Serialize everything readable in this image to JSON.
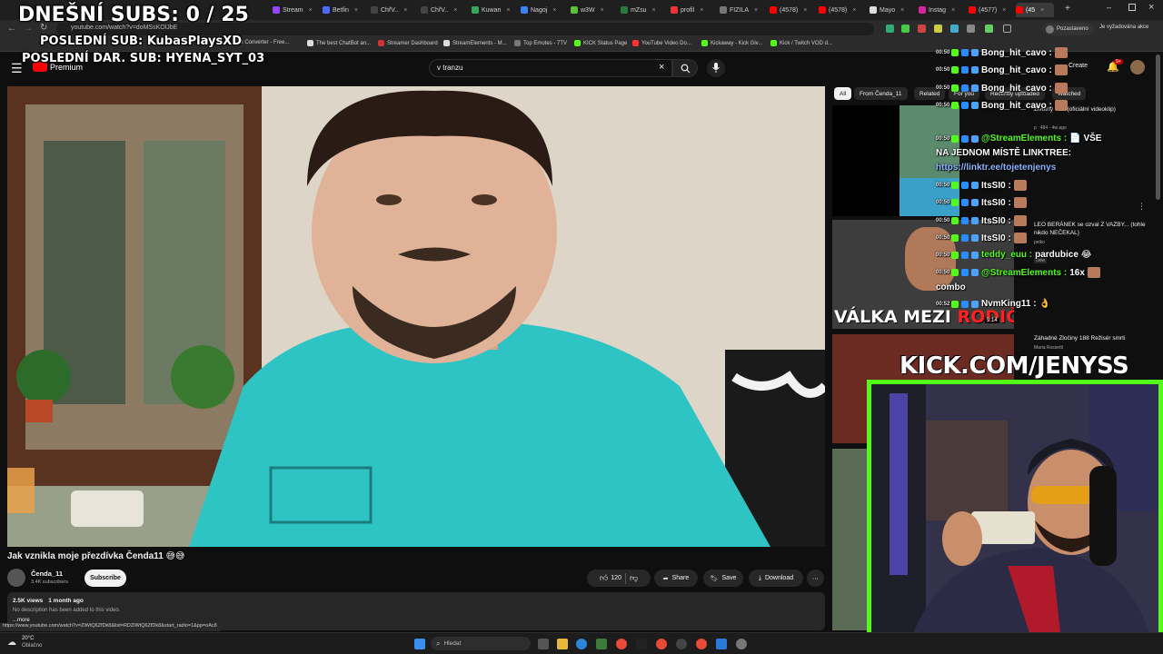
{
  "overlay": {
    "subs_goal": "DNEŠNÍ SUBS: 0 / 25",
    "last_sub": "POSLEDNÍ SUB: KubasPlaysXD",
    "last_gift_sub": "POSLEDNÍ DAR. SUB: HYENA_SYT_03",
    "kick_url": "KICK.COM/JENYSS"
  },
  "browser": {
    "tabs": [
      "Stream",
      "Betfin",
      "ChřV..",
      "ChřV..",
      "Kuwan",
      "Nagoj",
      "w3W",
      "mZsu",
      "profil",
      "FIZILA",
      "(4578)",
      "(4578)",
      "Mayo",
      "Instag",
      "(4577)",
      "(45"
    ],
    "address": "youtube.com/watch?v=doMSsKOlJbE",
    "account": "Pozastaveno",
    "account_note": "Je vyžadována akce",
    "bookmarks": [
      "File Converter - Free...",
      "The best ChatBot an...",
      "Streamer Dashboard",
      "StreamElements - M...",
      "Top Emotes - 7TV",
      "KICK Status Page",
      "YouTube Video Do...",
      "Kickaway - Kick Giv...",
      "Kick / Twitch VOD d..."
    ]
  },
  "youtube": {
    "logo_suffix": "Premium",
    "search_value": "v tranzu",
    "create_label": "Create",
    "notif_count": "9+",
    "chips": [
      "All",
      "From Čenda_11",
      "Related",
      "For you",
      "Recently uploaded",
      "Watched"
    ],
    "video_title": "Jak vznikla moje přezdívka Čenda11 😅😅",
    "channel_name": "Čenda_11",
    "subscribers": "3.4K subscribers",
    "subscribe_label": "Subscribe",
    "likes": "120",
    "share_label": "Share",
    "save_label": "Save",
    "download_label": "Download",
    "views": "2.5K views",
    "age": "1 month ago",
    "description": "No description has been added to this video.",
    "more_label": "...more",
    "status_url": "https://www.youtube.com/watch?v=ZiWtQ6ZfDk8&list=RDZiWtQ6ZfDk8&start_radio=1&pp=oAc8",
    "recommendations": [
      {
        "title": "Životný vibe (oficiální videoklip)",
        "channel": "p",
        "meta": "484 · 4w ago",
        "duration": ""
      },
      {
        "title": "LEO BERÁNEK se ozval Z VAZBY... (tohle nikdo NEČEKAL)",
        "channel": "pelko",
        "meta": "New",
        "duration": "9:14",
        "thumb_text_a": "VÁLKA MEZI ",
        "thumb_text_b": "RODIČI?!"
      },
      {
        "title": "Záhadné Zločiny 188 Režisér smrti",
        "channel": "Maria Rossetti",
        "meta": "",
        "duration": ""
      }
    ]
  },
  "chat": [
    {
      "ts": "00:50",
      "user": "Bong_hit_cavo :",
      "msg": "",
      "emote": true,
      "color": "#ffffff"
    },
    {
      "ts": "00:50",
      "user": "Bong_hit_cavo :",
      "msg": "",
      "emote": true,
      "color": "#ffffff"
    },
    {
      "ts": "00:50",
      "user": "Bong_hit_cavo :",
      "msg": "",
      "emote": true,
      "color": "#ffffff"
    },
    {
      "ts": "00:50",
      "user": "Bong_hit_cavo :",
      "msg": "",
      "emote": true,
      "color": "#ffffff"
    },
    {
      "ts": "00:50",
      "user": "@StreamElements :",
      "msg": "📄 VŠE",
      "emote": false,
      "color": "#53fc18"
    },
    {
      "ts": "",
      "user": "",
      "msg": "NA JEDNOM MÍSTĚ LINKTREE:",
      "emote": false,
      "color": "#ffffff"
    },
    {
      "ts": "",
      "user": "",
      "msg": "https://linktr.ee/tojetenjenys",
      "emote": false,
      "color": "#8ab4ff"
    },
    {
      "ts": "00:50",
      "user": "ItsSI0 :",
      "msg": "",
      "emote": true,
      "color": "#ffffff"
    },
    {
      "ts": "00:50",
      "user": "ItsSI0 :",
      "msg": "",
      "emote": true,
      "color": "#ffffff"
    },
    {
      "ts": "00:50",
      "user": "ItsSI0 :",
      "msg": "",
      "emote": true,
      "color": "#ffffff"
    },
    {
      "ts": "00:50",
      "user": "ItsSI0 :",
      "msg": "",
      "emote": true,
      "color": "#ffffff"
    },
    {
      "ts": "00:50",
      "user": "teddy_euu :",
      "msg": "pardubice 😂",
      "emote": false,
      "color": "#53fc18"
    },
    {
      "ts": "00:50",
      "user": "@StreamElements :",
      "msg": "16x",
      "emote": true,
      "color": "#53fc18"
    },
    {
      "ts": "",
      "user": "",
      "msg": "combo",
      "emote": false,
      "color": "#ffffff"
    },
    {
      "ts": "00:52",
      "user": "NvmKing11 :",
      "msg": "👌",
      "emote": false,
      "color": "#ffffff"
    }
  ],
  "taskbar": {
    "temperature": "20°C",
    "weather": "Oblačno",
    "search_placeholder": "Hledat"
  },
  "colors": {
    "kick_green": "#53fc18",
    "yt_red": "#ff0000",
    "video_tshirt": "#2ec4c4"
  }
}
